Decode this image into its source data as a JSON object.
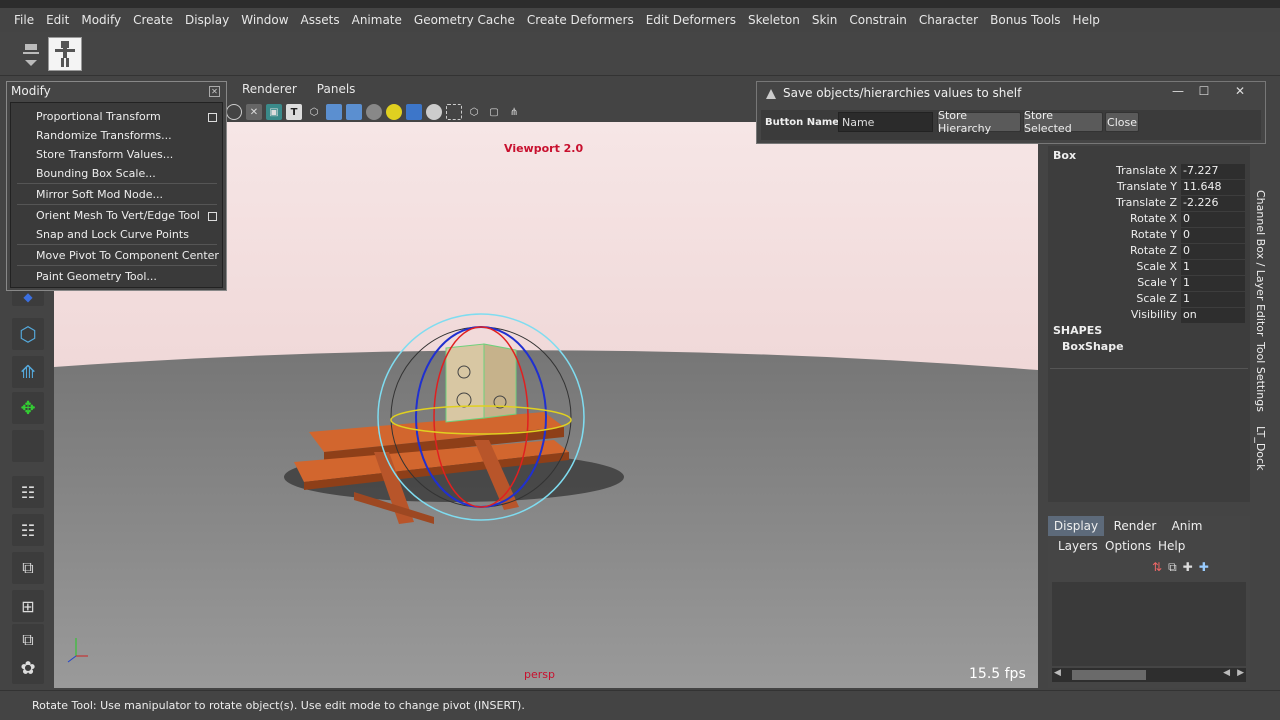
{
  "menubar": {
    "items": [
      "File",
      "Edit",
      "Modify",
      "Create",
      "Display",
      "Window",
      "Assets",
      "Animate",
      "Geometry Cache",
      "Create Deformers",
      "Edit Deformers",
      "Skeleton",
      "Skin",
      "Constrain",
      "Character",
      "Bonus Tools",
      "Help"
    ]
  },
  "panel_menu": {
    "renderer": "Renderer",
    "panels": "Panels"
  },
  "viewport": {
    "label": "Viewport 2.0",
    "camera": "persp",
    "fps": "15.5 fps",
    "colors": {
      "sky": "#f6e6e6",
      "ground": "#8a8a8a",
      "table": "#d2662e",
      "box": "#d8c7a3"
    }
  },
  "modify_menu": {
    "title": "Modify",
    "close_icon": "close-icon",
    "items": [
      {
        "label": "Proportional Transform",
        "option_box": true
      },
      {
        "label": "Randomize Transforms...",
        "option_box": false
      },
      {
        "label": "Store Transform Values...",
        "option_box": false
      },
      {
        "label": "Bounding Box Scale...",
        "option_box": false
      },
      {
        "label": "Mirror Soft Mod Node...",
        "option_box": false
      },
      {
        "label": "Orient Mesh To Vert/Edge Tool",
        "option_box": true
      },
      {
        "label": "Snap and Lock Curve Points",
        "option_box": false
      },
      {
        "label": "Move Pivot To Component Center",
        "option_box": false
      },
      {
        "label": "Paint Geometry Tool...",
        "option_box": false
      }
    ]
  },
  "save_dialog": {
    "title": "Save objects/hierarchies values to shelf",
    "button_name_label": "Button Name :",
    "button_name_value": "Name",
    "store_hierarchy": "Store Hierarchy",
    "store_selected": "Store Selected",
    "close": "Close"
  },
  "channel_box": {
    "object": "Box",
    "attributes": [
      {
        "label": "Translate X",
        "value": "-7.227"
      },
      {
        "label": "Translate Y",
        "value": "11.648"
      },
      {
        "label": "Translate Z",
        "value": "-2.226"
      },
      {
        "label": "Rotate X",
        "value": "0"
      },
      {
        "label": "Rotate Y",
        "value": "0"
      },
      {
        "label": "Rotate Z",
        "value": "0"
      },
      {
        "label": "Scale X",
        "value": "1"
      },
      {
        "label": "Scale Y",
        "value": "1"
      },
      {
        "label": "Scale Z",
        "value": "1"
      },
      {
        "label": "Visibility",
        "value": "on"
      }
    ],
    "shapes_header": "SHAPES",
    "shape_name": "BoxShape"
  },
  "side_tabs": [
    "Channel Box / Layer Editor",
    "Tool Settings",
    "LT_Dock"
  ],
  "layer_editor": {
    "tabs": [
      "Display",
      "Render",
      "Anim"
    ],
    "menus": [
      "Layers",
      "Options",
      "Help"
    ]
  },
  "status": {
    "text": "Rotate Tool: Use manipulator to rotate object(s). Use edit mode to change pivot (INSERT)."
  }
}
